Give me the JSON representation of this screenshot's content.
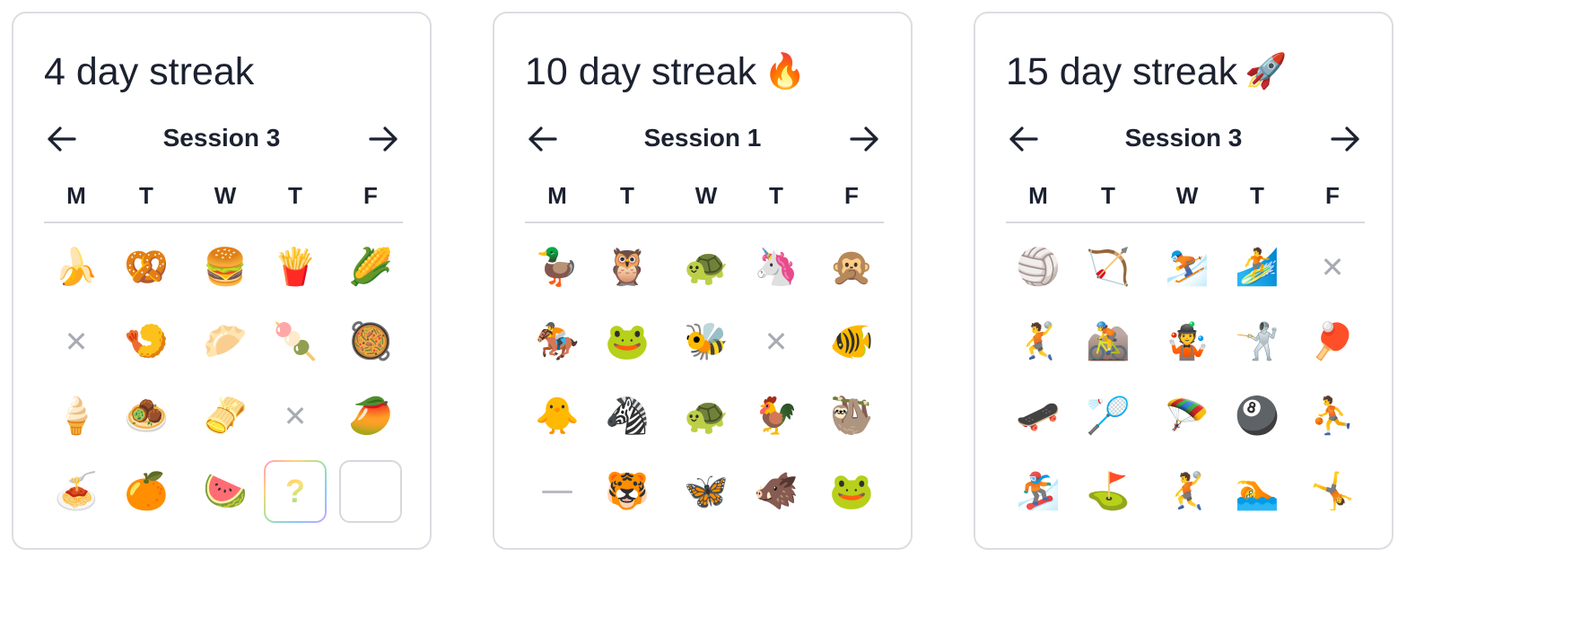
{
  "weekdays": [
    "M",
    "T",
    "W",
    "T",
    "F"
  ],
  "cards": [
    {
      "title": "4 day streak",
      "title_emoji": "",
      "session_label": "Session 3",
      "prev_icon": "arrow-left-icon",
      "next_icon": "arrow-right-icon",
      "grid": [
        [
          {
            "kind": "emoji",
            "value": "🍌"
          },
          {
            "kind": "emoji",
            "value": "🥨"
          },
          {
            "kind": "emoji",
            "value": "🍔"
          },
          {
            "kind": "emoji",
            "value": "🍟"
          },
          {
            "kind": "emoji",
            "value": "🌽"
          }
        ],
        [
          {
            "kind": "missed",
            "value": "✕"
          },
          {
            "kind": "emoji",
            "value": "🍤"
          },
          {
            "kind": "emoji",
            "value": "🥟"
          },
          {
            "kind": "emoji",
            "value": "🍡"
          },
          {
            "kind": "emoji",
            "value": "🥘"
          }
        ],
        [
          {
            "kind": "emoji",
            "value": "🍦"
          },
          {
            "kind": "emoji",
            "value": "🧆"
          },
          {
            "kind": "emoji",
            "value": "🫔"
          },
          {
            "kind": "missed",
            "value": "✕"
          },
          {
            "kind": "emoji",
            "value": "🥭"
          }
        ],
        [
          {
            "kind": "emoji",
            "value": "🍝"
          },
          {
            "kind": "emoji",
            "value": "🍊"
          },
          {
            "kind": "emoji",
            "value": "🍉"
          },
          {
            "kind": "today",
            "value": "?"
          },
          {
            "kind": "future",
            "value": ""
          }
        ]
      ]
    },
    {
      "title": "10 day streak",
      "title_emoji": "🔥",
      "session_label": "Session 1",
      "prev_icon": "arrow-left-icon",
      "next_icon": "arrow-right-icon",
      "grid": [
        [
          {
            "kind": "emoji",
            "value": "🦆"
          },
          {
            "kind": "emoji",
            "value": "🦉"
          },
          {
            "kind": "emoji",
            "value": "🐢"
          },
          {
            "kind": "emoji",
            "value": "🦄"
          },
          {
            "kind": "emoji",
            "value": "🙊"
          }
        ],
        [
          {
            "kind": "emoji",
            "value": "🏇"
          },
          {
            "kind": "emoji",
            "value": "🐸"
          },
          {
            "kind": "emoji",
            "value": "🐝"
          },
          {
            "kind": "missed",
            "value": "✕"
          },
          {
            "kind": "emoji",
            "value": "🐠"
          }
        ],
        [
          {
            "kind": "emoji",
            "value": "🐥"
          },
          {
            "kind": "emoji",
            "value": "🦓"
          },
          {
            "kind": "emoji",
            "value": "🐢"
          },
          {
            "kind": "emoji",
            "value": "🐓"
          },
          {
            "kind": "emoji",
            "value": "🦥"
          }
        ],
        [
          {
            "kind": "none",
            "value": ""
          },
          {
            "kind": "emoji",
            "value": "🐯"
          },
          {
            "kind": "emoji",
            "value": "🦋"
          },
          {
            "kind": "emoji",
            "value": "🐗"
          },
          {
            "kind": "emoji",
            "value": "🐸"
          }
        ]
      ]
    },
    {
      "title": "15 day streak",
      "title_emoji": "🚀",
      "session_label": "Session 3",
      "prev_icon": "arrow-left-icon",
      "next_icon": "arrow-right-icon",
      "grid": [
        [
          {
            "kind": "emoji",
            "value": "🏐"
          },
          {
            "kind": "emoji",
            "value": "🏹"
          },
          {
            "kind": "emoji",
            "value": "⛷️"
          },
          {
            "kind": "emoji",
            "value": "🏄"
          },
          {
            "kind": "missed",
            "value": "✕"
          }
        ],
        [
          {
            "kind": "emoji",
            "value": "🤾"
          },
          {
            "kind": "emoji",
            "value": "🚵"
          },
          {
            "kind": "emoji",
            "value": "🤹"
          },
          {
            "kind": "emoji",
            "value": "🤺"
          },
          {
            "kind": "emoji",
            "value": "🏓"
          }
        ],
        [
          {
            "kind": "emoji",
            "value": "🛹"
          },
          {
            "kind": "emoji",
            "value": "🏸"
          },
          {
            "kind": "emoji",
            "value": "🪂"
          },
          {
            "kind": "emoji",
            "value": "🎱"
          },
          {
            "kind": "emoji",
            "value": "⛹️"
          }
        ],
        [
          {
            "kind": "emoji",
            "value": "🏂"
          },
          {
            "kind": "emoji",
            "value": "⛳"
          },
          {
            "kind": "emoji",
            "value": "🤾"
          },
          {
            "kind": "emoji",
            "value": "🏊"
          },
          {
            "kind": "emoji",
            "value": "🤸"
          }
        ]
      ]
    }
  ]
}
